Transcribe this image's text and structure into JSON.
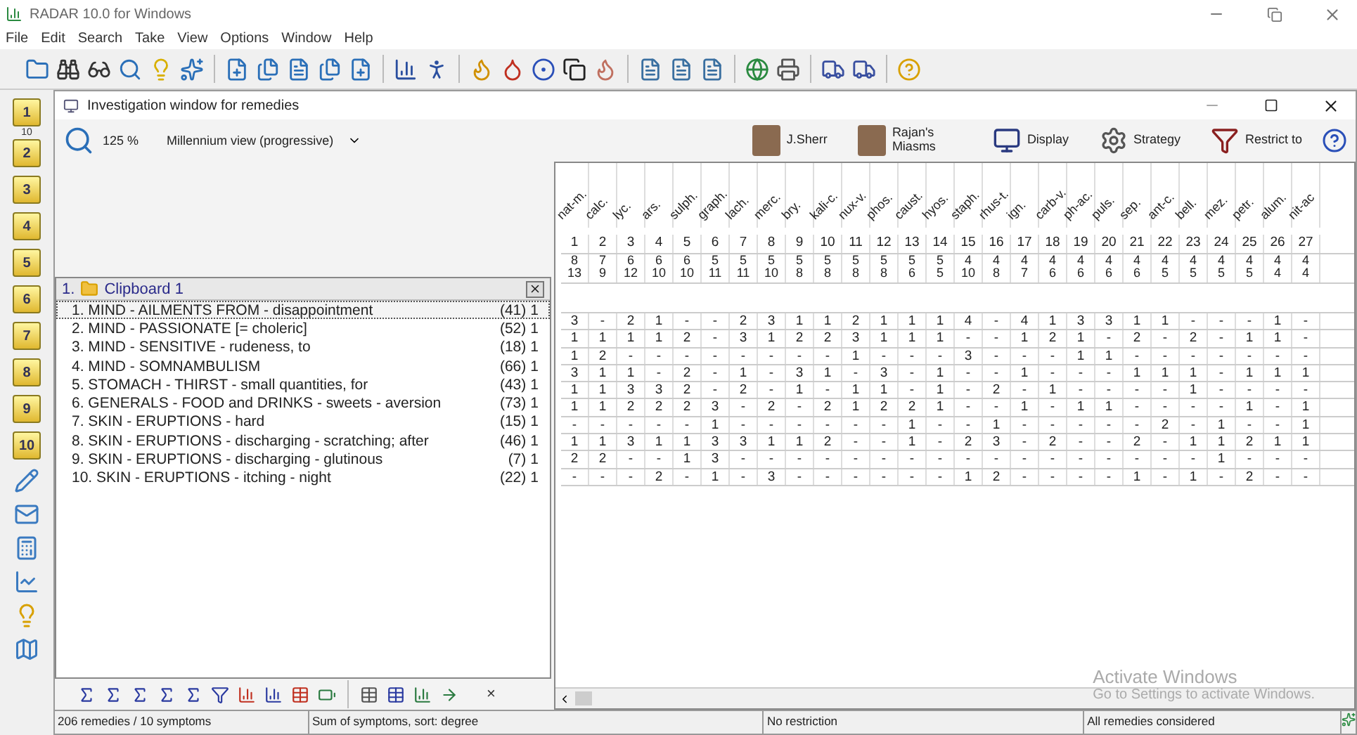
{
  "app": {
    "title": "RADAR 10.0 for Windows",
    "menu": [
      "File",
      "Edit",
      "Search",
      "Take",
      "View",
      "Options",
      "Window",
      "Help"
    ]
  },
  "side_buttons": [
    {
      "label": "1",
      "kind": "tab"
    },
    {
      "label": "10",
      "kind": "count"
    },
    {
      "label": "2",
      "kind": "tab"
    },
    {
      "label": "3",
      "kind": "tab"
    },
    {
      "label": "4",
      "kind": "tab"
    },
    {
      "label": "5",
      "kind": "tab"
    },
    {
      "label": "6",
      "kind": "tab"
    },
    {
      "label": "7",
      "kind": "tab"
    },
    {
      "label": "8",
      "kind": "tab"
    },
    {
      "label": "9",
      "kind": "tab"
    },
    {
      "label": "10",
      "kind": "tab"
    }
  ],
  "window": {
    "title": "Investigation window for remedies",
    "zoom": "125 %",
    "view_select": "Millennium view (progressive)",
    "tools": [
      {
        "label": "J.Sherr",
        "kind": "avatar"
      },
      {
        "label": "Rajan's Miasms",
        "kind": "avatar"
      },
      {
        "label": "Display",
        "kind": "display"
      },
      {
        "label": "Strategy",
        "kind": "gear"
      },
      {
        "label": "Restrict to",
        "kind": "restrict"
      }
    ]
  },
  "clipboard": {
    "index": "1.",
    "title": "Clipboard 1",
    "rubrics": [
      {
        "text": "1. MIND - AILMENTS FROM - disappointment",
        "count": "(41)",
        "weight": "1",
        "selected": true
      },
      {
        "text": "2. MIND - PASSIONATE [= choleric]",
        "count": "(52)",
        "weight": "1",
        "selected": false
      },
      {
        "text": "3. MIND - SENSITIVE - rudeness, to",
        "count": "(18)",
        "weight": "1",
        "selected": false
      },
      {
        "text": "4. MIND - SOMNAMBULISM",
        "count": "(66)",
        "weight": "1",
        "selected": false
      },
      {
        "text": "5. STOMACH - THIRST - small quantities, for",
        "count": "(43)",
        "weight": "1",
        "selected": false
      },
      {
        "text": "6. GENERALS - FOOD and DRINKS - sweets - aversion",
        "count": "(73)",
        "weight": "1",
        "selected": false
      },
      {
        "text": "7. SKIN - ERUPTIONS - hard",
        "count": "(15)",
        "weight": "1",
        "selected": false
      },
      {
        "text": "8. SKIN - ERUPTIONS - discharging - scratching; after",
        "count": "(46)",
        "weight": "1",
        "selected": false
      },
      {
        "text": "9. SKIN - ERUPTIONS - discharging - glutinous",
        "count": "(7)",
        "weight": "1",
        "selected": false
      },
      {
        "text": "10. SKIN - ERUPTIONS - itching - night",
        "count": "(22)",
        "weight": "1",
        "selected": false
      }
    ]
  },
  "grid": {
    "remedies": [
      {
        "name": "nat-m.",
        "number": "1",
        "score": "8",
        "degree": "13"
      },
      {
        "name": "calc.",
        "number": "2",
        "score": "7",
        "degree": "9"
      },
      {
        "name": "lyc.",
        "number": "3",
        "score": "6",
        "degree": "12"
      },
      {
        "name": "ars.",
        "number": "4",
        "score": "6",
        "degree": "10"
      },
      {
        "name": "sulph.",
        "number": "5",
        "score": "6",
        "degree": "10"
      },
      {
        "name": "graph.",
        "number": "6",
        "score": "5",
        "degree": "11"
      },
      {
        "name": "lach.",
        "number": "7",
        "score": "5",
        "degree": "11"
      },
      {
        "name": "merc.",
        "number": "8",
        "score": "5",
        "degree": "10"
      },
      {
        "name": "bry.",
        "number": "9",
        "score": "5",
        "degree": "8"
      },
      {
        "name": "kali-c.",
        "number": "10",
        "score": "5",
        "degree": "8"
      },
      {
        "name": "nux-v.",
        "number": "11",
        "score": "5",
        "degree": "8"
      },
      {
        "name": "phos.",
        "number": "12",
        "score": "5",
        "degree": "8"
      },
      {
        "name": "caust.",
        "number": "13",
        "score": "5",
        "degree": "6"
      },
      {
        "name": "hyos.",
        "number": "14",
        "score": "5",
        "degree": "5"
      },
      {
        "name": "staph.",
        "number": "15",
        "score": "4",
        "degree": "10"
      },
      {
        "name": "rhus-t.",
        "number": "16",
        "score": "4",
        "degree": "8"
      },
      {
        "name": "ign.",
        "number": "17",
        "score": "4",
        "degree": "7"
      },
      {
        "name": "carb-v.",
        "number": "18",
        "score": "4",
        "degree": "6"
      },
      {
        "name": "ph-ac.",
        "number": "19",
        "score": "4",
        "degree": "6"
      },
      {
        "name": "puls.",
        "number": "20",
        "score": "4",
        "degree": "6"
      },
      {
        "name": "sep.",
        "number": "21",
        "score": "4",
        "degree": "6"
      },
      {
        "name": "ant-c.",
        "number": "22",
        "score": "4",
        "degree": "5"
      },
      {
        "name": "bell.",
        "number": "23",
        "score": "4",
        "degree": "5"
      },
      {
        "name": "mez.",
        "number": "24",
        "score": "4",
        "degree": "5"
      },
      {
        "name": "petr.",
        "number": "25",
        "score": "4",
        "degree": "5"
      },
      {
        "name": "alum.",
        "number": "26",
        "score": "4",
        "degree": "4"
      },
      {
        "name": "nit-ac",
        "number": "27",
        "score": "4",
        "degree": "4"
      }
    ],
    "rows": [
      [
        "3",
        "-",
        "2",
        "1",
        "-",
        "-",
        "2",
        "3",
        "1",
        "1",
        "2",
        "1",
        "1",
        "1",
        "4",
        "-",
        "4",
        "1",
        "3",
        "3",
        "1",
        "1",
        "-",
        "-",
        "-",
        "1",
        "-"
      ],
      [
        "1",
        "1",
        "1",
        "1",
        "2",
        "-",
        "3",
        "1",
        "2",
        "2",
        "3",
        "1",
        "1",
        "1",
        "-",
        "-",
        "1",
        "2",
        "1",
        "-",
        "2",
        "-",
        "2",
        "-",
        "1",
        "1",
        "-"
      ],
      [
        "1",
        "2",
        "-",
        "-",
        "-",
        "-",
        "-",
        "-",
        "-",
        "-",
        "1",
        "-",
        "-",
        "-",
        "3",
        "-",
        "-",
        "-",
        "1",
        "1",
        "-",
        "-",
        "-",
        "-",
        "-",
        "-",
        "-"
      ],
      [
        "3",
        "1",
        "1",
        "-",
        "2",
        "-",
        "1",
        "-",
        "3",
        "1",
        "-",
        "3",
        "-",
        "1",
        "-",
        "-",
        "1",
        "-",
        "-",
        "-",
        "1",
        "1",
        "1",
        "-",
        "1",
        "1",
        "1"
      ],
      [
        "1",
        "1",
        "3",
        "3",
        "2",
        "-",
        "2",
        "-",
        "1",
        "-",
        "1",
        "1",
        "-",
        "1",
        "-",
        "2",
        "-",
        "1",
        "-",
        "-",
        "-",
        "-",
        "1",
        "-",
        "-",
        "-",
        "-"
      ],
      [
        "1",
        "1",
        "2",
        "2",
        "2",
        "3",
        "-",
        "2",
        "-",
        "2",
        "1",
        "2",
        "2",
        "1",
        "-",
        "-",
        "1",
        "-",
        "1",
        "1",
        "-",
        "-",
        "-",
        "-",
        "1",
        "-",
        "1"
      ],
      [
        "-",
        "-",
        "-",
        "-",
        "-",
        "1",
        "-",
        "-",
        "-",
        "-",
        "-",
        "-",
        "1",
        "-",
        "-",
        "1",
        "-",
        "-",
        "-",
        "-",
        "-",
        "2",
        "-",
        "1",
        "-",
        "-",
        "1"
      ],
      [
        "1",
        "1",
        "3",
        "1",
        "1",
        "3",
        "3",
        "1",
        "1",
        "2",
        "-",
        "-",
        "1",
        "-",
        "2",
        "3",
        "-",
        "2",
        "-",
        "-",
        "2",
        "-",
        "1",
        "1",
        "2",
        "1",
        "1"
      ],
      [
        "2",
        "2",
        "-",
        "-",
        "1",
        "3",
        "-",
        "-",
        "-",
        "-",
        "-",
        "-",
        "-",
        "-",
        "-",
        "-",
        "-",
        "-",
        "-",
        "-",
        "-",
        "-",
        "-",
        "1",
        "-",
        "-",
        "-"
      ],
      [
        "-",
        "-",
        "-",
        "2",
        "-",
        "1",
        "-",
        "3",
        "-",
        "-",
        "-",
        "-",
        "-",
        "-",
        "1",
        "2",
        "-",
        "-",
        "-",
        "-",
        "1",
        "-",
        "1",
        "-",
        "2",
        "-",
        "-"
      ]
    ]
  },
  "bottom_close": "×",
  "os_notice": {
    "title": "Activate Windows",
    "text": "Go to Settings to activate Windows."
  },
  "status_bar": [
    "206 remedies / 10 symptoms",
    "Sum of symptoms, sort: degree",
    "No restriction",
    "All remedies considered"
  ]
}
